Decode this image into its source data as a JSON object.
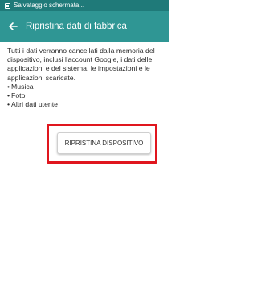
{
  "status_bar": {
    "notification_text": "Salvataggio schermata..."
  },
  "app_bar": {
    "back_icon": "back-arrow-icon",
    "title": "Ripristina dati di fabbrica"
  },
  "content": {
    "description": "Tutti i dati verranno cancellati dalla memoria del dispositivo, inclusi l'account Google, i dati delle applicazioni e del sistema, le impostazioni e le applicazioni scaricate.",
    "items": [
      "Musica",
      "Foto",
      "Altri dati utente"
    ]
  },
  "reset_button": {
    "label": "RIPRISTINA DISPOSITIVO"
  },
  "colors": {
    "status_bar": "#1f7a79",
    "app_bar": "#2f9694",
    "highlight": "#e0161e"
  }
}
